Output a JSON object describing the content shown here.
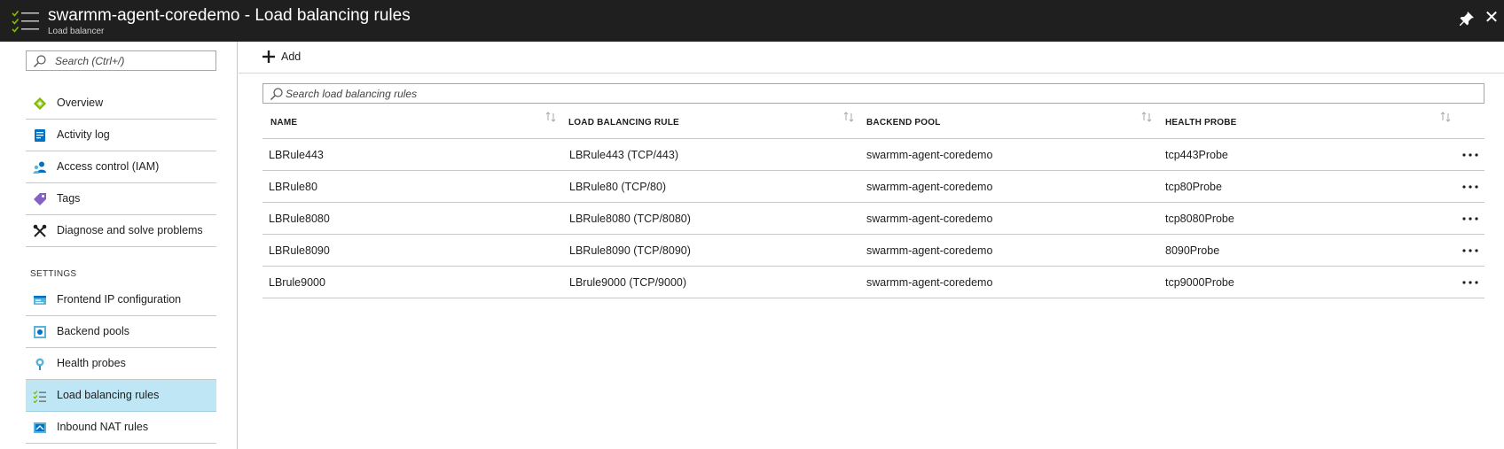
{
  "window": {
    "title": "swarmm-agent-coredemo - Load balancing rules",
    "subtitle": "Load balancer",
    "menu_icon": "hamburger-checklist-icon",
    "pin_icon": "pin-icon",
    "close_glyph": "✕"
  },
  "sidebar": {
    "search_placeholder": "Search (Ctrl+/)",
    "section_label": "SETTINGS",
    "items": [
      {
        "label": "Overview",
        "icon": "overview-icon"
      },
      {
        "label": "Activity log",
        "icon": "activity-log-icon"
      },
      {
        "label": "Access control (IAM)",
        "icon": "access-control-icon"
      },
      {
        "label": "Tags",
        "icon": "tag-icon"
      },
      {
        "label": "Diagnose and solve problems",
        "icon": "wrench-icon"
      },
      {
        "label": "Frontend IP configuration",
        "icon": "frontend-ip-icon"
      },
      {
        "label": "Backend pools",
        "icon": "backend-pool-icon"
      },
      {
        "label": "Health probes",
        "icon": "health-probe-icon"
      },
      {
        "label": "Load balancing rules",
        "icon": "load-balancing-rules-icon",
        "active": true
      },
      {
        "label": "Inbound NAT rules",
        "icon": "inbound-nat-icon"
      }
    ]
  },
  "main": {
    "add_label": "Add",
    "search_placeholder": "Search load balancing rules",
    "columns": [
      "NAME",
      "LOAD BALANCING RULE",
      "BACKEND POOL",
      "HEALTH PROBE"
    ],
    "rows": [
      {
        "name": "LBRule443",
        "rule": "LBRule443 (TCP/443)",
        "pool": "swarmm-agent-coredemo",
        "probe": "tcp443Probe"
      },
      {
        "name": "LBRule80",
        "rule": "LBRule80 (TCP/80)",
        "pool": "swarmm-agent-coredemo",
        "probe": "tcp80Probe"
      },
      {
        "name": "LBRule8080",
        "rule": "LBRule8080 (TCP/8080)",
        "pool": "swarmm-agent-coredemo",
        "probe": "tcp8080Probe"
      },
      {
        "name": "LBRule8090",
        "rule": "LBRule8090 (TCP/8090)",
        "pool": "swarmm-agent-coredemo",
        "probe": "8090Probe"
      },
      {
        "name": "LBrule9000",
        "rule": "LBrule9000 (TCP/9000)",
        "pool": "swarmm-agent-coredemo",
        "probe": "tcp9000Probe"
      }
    ]
  },
  "colors": {
    "titlebar_bg": "#1f1f1f",
    "active_item_bg": "#bfe6f4",
    "accent_green": "#7fba00",
    "accent_blue": "#0072c6"
  }
}
